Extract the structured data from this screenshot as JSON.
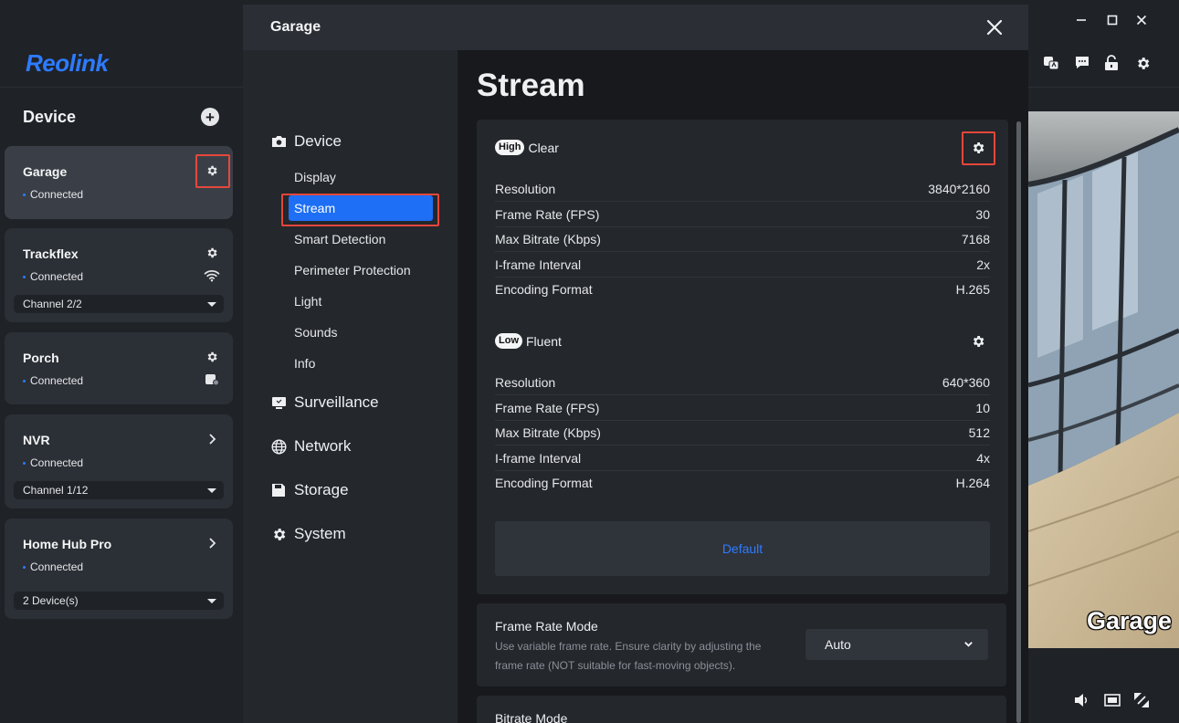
{
  "sidebar": {
    "logo": "Reolink",
    "heading": "Device",
    "devices": [
      {
        "name": "Garage",
        "status": "Connected",
        "action_icon": "gear-icon"
      },
      {
        "name": "Trackflex",
        "status": "Connected",
        "action_icon": "gear-icon",
        "status_icon": "wifi-icon",
        "selector": "Channel 2/2"
      },
      {
        "name": "Porch",
        "status": "Connected",
        "action_icon": "gear-icon",
        "status_icon": "battery-icon"
      },
      {
        "name": "NVR",
        "status": "Connected",
        "action_icon": "chevron-right-icon",
        "selector": "Channel 1/12"
      },
      {
        "name": "Home Hub Pro",
        "status": "Connected",
        "action_icon": "chevron-right-icon",
        "selector": "2 Device(s)"
      }
    ]
  },
  "modal": {
    "title": "Garage",
    "nav": {
      "device": "Device",
      "device_items": [
        "Display",
        "Stream",
        "Smart Detection",
        "Perimeter Protection",
        "Light",
        "Sounds",
        "Info"
      ],
      "active_item": "Stream",
      "surveillance": "Surveillance",
      "network": "Network",
      "storage": "Storage",
      "system": "System"
    },
    "content": {
      "title": "Stream",
      "high_stream": {
        "badge": "High",
        "name": "Clear",
        "params": [
          {
            "label": "Resolution",
            "value": "3840*2160"
          },
          {
            "label": "Frame Rate (FPS)",
            "value": "30"
          },
          {
            "label": "Max Bitrate (Kbps)",
            "value": "7168"
          },
          {
            "label": "I-frame Interval",
            "value": "2x"
          },
          {
            "label": "Encoding Format",
            "value": "H.265"
          }
        ]
      },
      "low_stream": {
        "badge": "Low",
        "name": "Fluent",
        "params": [
          {
            "label": "Resolution",
            "value": "640*360"
          },
          {
            "label": "Frame Rate (FPS)",
            "value": "10"
          },
          {
            "label": "Max Bitrate (Kbps)",
            "value": "512"
          },
          {
            "label": "I-frame Interval",
            "value": "4x"
          },
          {
            "label": "Encoding Format",
            "value": "H.264"
          }
        ]
      },
      "default_button": "Default",
      "frame_rate_mode": {
        "title": "Frame Rate Mode",
        "description": "Use variable frame rate. Ensure clarity by adjusting the frame rate (NOT suitable for fast-moving objects).",
        "value": "Auto"
      },
      "bitrate_mode": {
        "title": "Bitrate Mode"
      }
    }
  },
  "live_view": {
    "camera_label": "Garage"
  },
  "colors": {
    "accent": "#1e6ff5",
    "highlight": "#e5473b",
    "status_dot": "#2d7bff"
  }
}
